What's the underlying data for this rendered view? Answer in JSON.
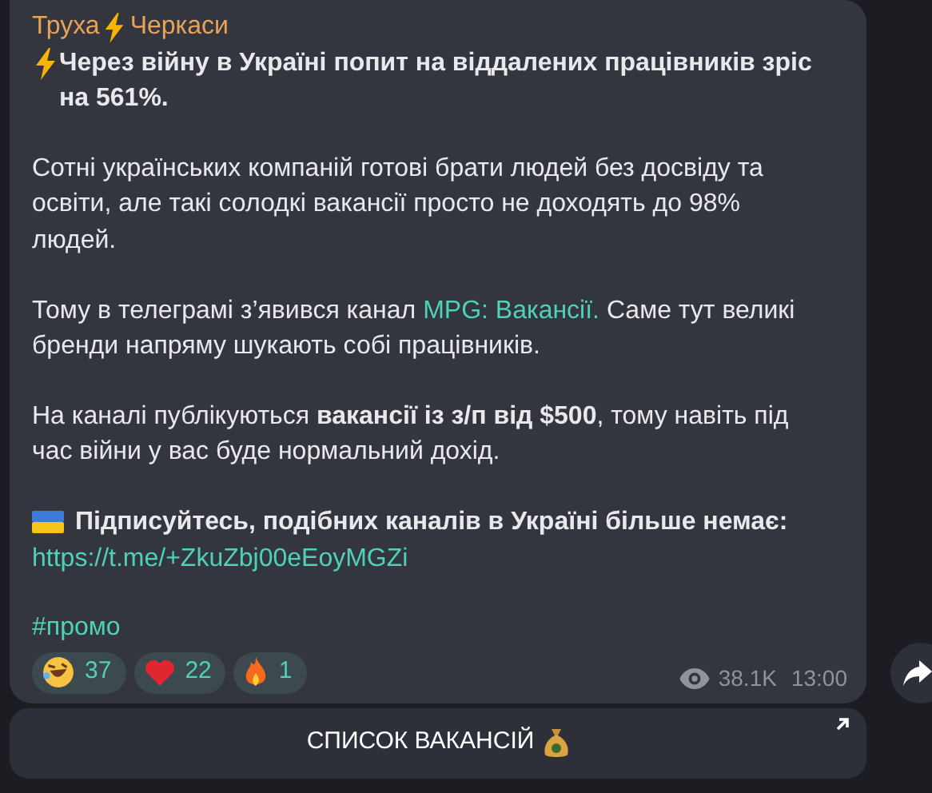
{
  "post": {
    "channel": {
      "before": "Труха",
      "after": "Черкаси"
    },
    "paragraphs": [
      {
        "kind": "headline",
        "segments": [
          {
            "kind": "bold",
            "text": "Через війну в Україні попит на віддалених працівників зріс на 561%."
          }
        ]
      },
      {
        "kind": "plain",
        "segments": [
          {
            "kind": "plain",
            "text": "Сотні українських компаній готові брати людей без досвіду та освіти, але такі солодкі вакансії просто не доходять до 98% людей."
          }
        ]
      },
      {
        "kind": "plain",
        "segments": [
          {
            "kind": "plain",
            "text": "Тому в телеграмі з’явився канал "
          },
          {
            "kind": "link",
            "text": "MPG: Вакансії."
          },
          {
            "kind": "plain",
            "text": " Саме тут великі бренди напряму шукають собі працівників."
          }
        ]
      },
      {
        "kind": "plain",
        "segments": [
          {
            "kind": "plain",
            "text": "На каналі публікуються **вакансії із з/п від $500**, тому навіть під час війни у вас буде нормальний дохід."
          }
        ]
      },
      {
        "kind": "flag",
        "segments": [
          {
            "kind": "bold",
            "text": "Підписуйтесь, подібних каналів в Україні більше немає:"
          }
        ],
        "url": "https://t.me/+ZkuZbj00eEoyMGZi"
      },
      {
        "kind": "tag",
        "segments": [
          {
            "kind": "link",
            "text": "#промо"
          }
        ]
      }
    ],
    "reactions": [
      {
        "kind": "laugh",
        "count": "37"
      },
      {
        "kind": "heart",
        "count": "22"
      },
      {
        "kind": "fire",
        "count": "1"
      }
    ],
    "views": "38.1K",
    "time": "13:00"
  },
  "button": {
    "label": "СПИСОК ВАКАНСІЙ"
  }
}
